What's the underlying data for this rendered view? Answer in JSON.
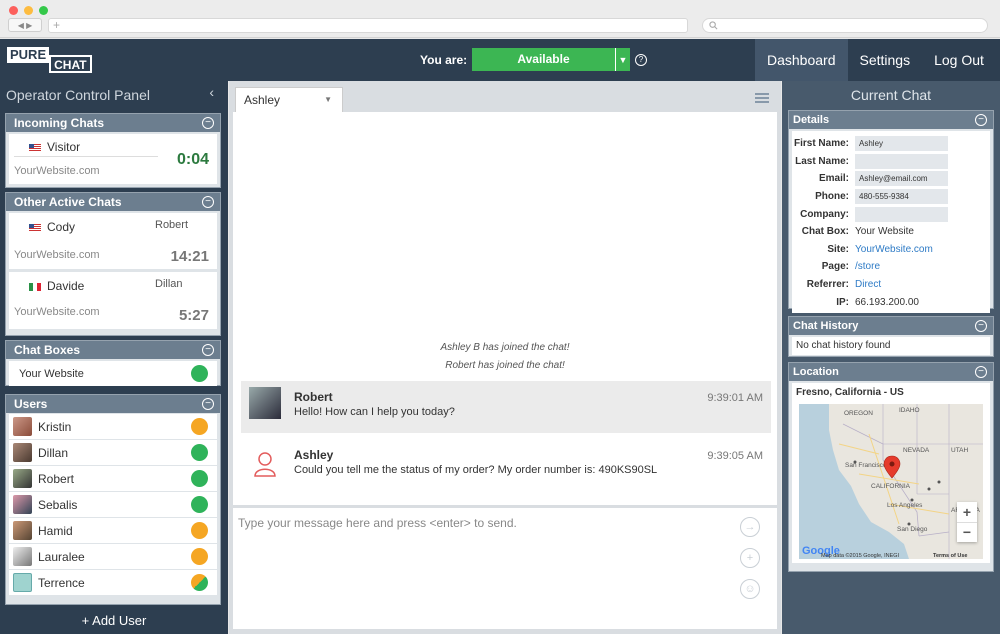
{
  "browser": {
    "tab_plus": "+",
    "search_icon": "search-icon",
    "nav": "◀ ▶",
    "colors": {
      "red": "#fc605c",
      "yellow": "#fdbc40",
      "green": "#34c84a"
    }
  },
  "topbar": {
    "logo_top": "PURE",
    "logo_bottom": "CHAT",
    "you_are": "You are:",
    "status": "Available",
    "status_color": "#3cb653",
    "help": "?",
    "nav": [
      "Dashboard",
      "Settings",
      "Log Out"
    ]
  },
  "left": {
    "title": "Operator Control Panel",
    "collapse": "‹",
    "incoming": {
      "title": "Incoming Chats",
      "visitor": "Visitor",
      "site": "YourWebsite.com",
      "timer": "0:04"
    },
    "active": {
      "title": "Other Active Chats",
      "chats": [
        {
          "visitor": "Cody",
          "operator": "Robert",
          "site": "YourWebsite.com",
          "time": "14:21"
        },
        {
          "visitor": "Davide",
          "operator": "Dillan",
          "site": "YourWebsite.com",
          "time": "5:27"
        }
      ]
    },
    "chatboxes": {
      "title": "Chat Boxes",
      "items": [
        "Your Website"
      ]
    },
    "users": {
      "title": "Users",
      "items": [
        "Kristin",
        "Dillan",
        "Robert",
        "Sebalis",
        "Hamid",
        "Lauralee",
        "Terrence"
      ]
    },
    "add_user": "+ Add User"
  },
  "mid": {
    "tab": "Ashley",
    "system": [
      "Ashley B has joined the chat!",
      "Robert has joined the chat!"
    ],
    "messages": [
      {
        "name": "Robert",
        "text": "Hello! How can I help you today?",
        "time": "9:39:01 AM"
      },
      {
        "name": "Ashley",
        "text": "Could you tell me the status of my order? My order number is: 490KS90SL",
        "time": "9:39:05 AM"
      }
    ],
    "placeholder": "Type your message here and press <enter> to send."
  },
  "right": {
    "title": "Current Chat",
    "details_title": "Details",
    "details": [
      {
        "label": "First Name:",
        "value": "Ashley",
        "type": "box"
      },
      {
        "label": "Last Name:",
        "value": "",
        "type": "box"
      },
      {
        "label": "Email:",
        "value": "Ashley@email.com",
        "type": "box"
      },
      {
        "label": "Phone:",
        "value": "480-555-9384",
        "type": "box"
      },
      {
        "label": "Company:",
        "value": "",
        "type": "box"
      },
      {
        "label": "Chat Box:",
        "value": "Your Website",
        "type": "text"
      },
      {
        "label": "Site:",
        "value": "YourWebsite.com",
        "type": "link"
      },
      {
        "label": "Page:",
        "value": "/store",
        "type": "link"
      },
      {
        "label": "Referrer:",
        "value": "Direct",
        "type": "link"
      },
      {
        "label": "IP:",
        "value": "66.193.200.00",
        "type": "text"
      }
    ],
    "history_title": "Chat History",
    "history_text": "No chat history found",
    "location_title": "Location",
    "location_text": "Fresno, California - US",
    "map": {
      "labels": [
        "OREGON",
        "IDAHO",
        "NEVADA",
        "San Francisco",
        "CALIFORNIA",
        "Los Angeles",
        "San Diego",
        "ARIZONA",
        "UTAH"
      ],
      "attribution": "Map data ©2015 Google, INEGI",
      "terms": "Terms of Use",
      "logo": "Google",
      "zoom_in": "+",
      "zoom_out": "−"
    }
  }
}
